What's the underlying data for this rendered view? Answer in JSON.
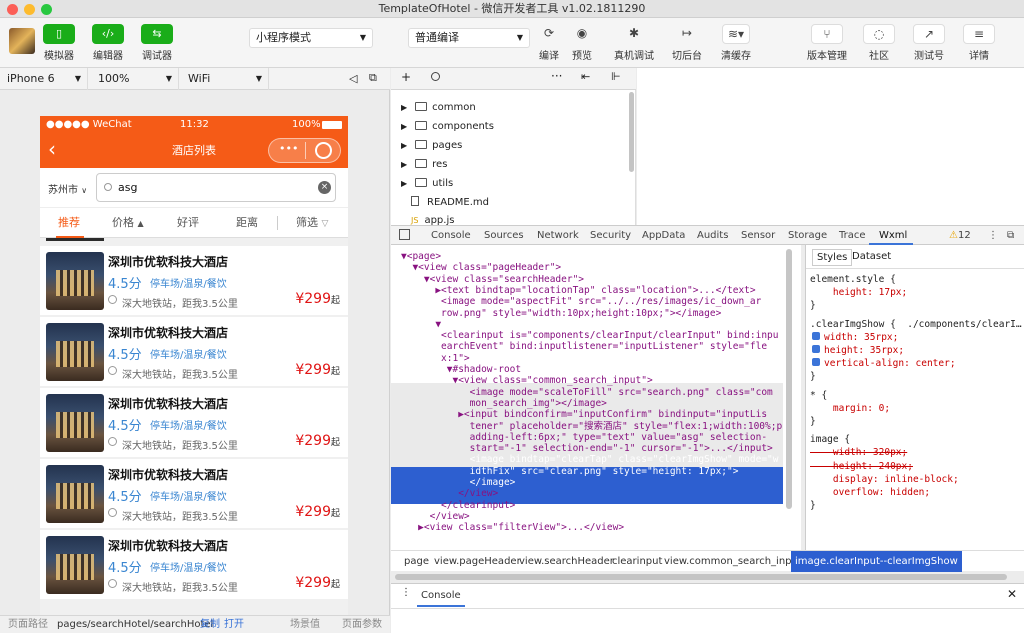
{
  "window": {
    "title": "TemplateOfHotel - 微信开发者工具 v1.02.1811290"
  },
  "toolbar": {
    "simulator": "模拟器",
    "editor": "编辑器",
    "debugger": "调试器",
    "mode_select": "小程序模式",
    "compile_select": "普通编译",
    "compile": "编译",
    "preview": "预览",
    "remote_debug": "真机调试",
    "background": "切后台",
    "clear_cache": "清缓存",
    "version": "版本管理",
    "community": "社区",
    "test": "测试号",
    "details": "详情"
  },
  "devicebar": {
    "device": "iPhone 6",
    "zoom": "100%",
    "network": "WiFi"
  },
  "phone": {
    "status": {
      "carrier": "●●●●● WeChat",
      "time": "11:32",
      "battery": "100%"
    },
    "nav_title": "酒店列表",
    "city": "苏州市",
    "search_value": "asg",
    "filters": [
      "推荐",
      "价格",
      "好评",
      "距离",
      "筛选"
    ],
    "hotels": [
      {
        "name": "深圳市优软科技大酒店",
        "score": "4.5分",
        "tags": "停车场/温泉/餐饮",
        "address": "深大地铁站，距我3.5公里",
        "price": "¥299",
        "suffix": "起"
      },
      {
        "name": "深圳市优软科技大酒店",
        "score": "4.5分",
        "tags": "停车场/温泉/餐饮",
        "address": "深大地铁站，距我3.5公里",
        "price": "¥299",
        "suffix": "起"
      },
      {
        "name": "深圳市优软科技大酒店",
        "score": "4.5分",
        "tags": "停车场/温泉/餐饮",
        "address": "深大地铁站，距我3.5公里",
        "price": "¥299",
        "suffix": "起"
      },
      {
        "name": "深圳市优软科技大酒店",
        "score": "4.5分",
        "tags": "停车场/温泉/餐饮",
        "address": "深大地铁站，距我3.5公里",
        "price": "¥299",
        "suffix": "起"
      },
      {
        "name": "深圳市优软科技大酒店",
        "score": "4.5分",
        "tags": "停车场/温泉/餐饮",
        "address": "深大地铁站，距我3.5公里",
        "price": "¥299",
        "suffix": "起"
      }
    ]
  },
  "bottombar": {
    "path_label": "页面路径",
    "path": "pages/searchHotel/searchHotel",
    "copy": "复制",
    "open": "打开",
    "scene": "场景值",
    "params": "页面参数"
  },
  "tree": {
    "items": [
      "common",
      "components",
      "pages",
      "res",
      "utils",
      "README.md",
      "app.js"
    ]
  },
  "devtools": {
    "tabs": [
      "Console",
      "Sources",
      "Network",
      "Security",
      "AppData",
      "Audits",
      "Sensor",
      "Storage",
      "Trace",
      "Wxml"
    ],
    "warnings": "12",
    "style_tabs": [
      "Styles",
      "Dataset"
    ],
    "dom_lines": [
      "▼<page>",
      "  ▼<view class=\"pageHeader\">",
      "    ▼<view class=\"searchHeader\">",
      "      ▶<text bindtap=\"locationTap\" class=\"location\">...</text>",
      "       <image mode=\"aspectFit\" src=\"../../res/images/ic_down_ar",
      "       row.png\" style=\"width:10px;height:10px;\"></image>",
      "      ▼",
      "       <clearinput is=\"components/clearInput/clearInput\" bind:inpu",
      "       earchEvent\" bind:inputlistener=\"inputListener\" style=\"fle",
      "       x:1\">",
      "        ▼#shadow-root",
      "         ▼<view class=\"common_search_input\">",
      "            <image mode=\"scaleToFill\" src=\"search.png\" class=\"com",
      "            mon_search_img\"></image>",
      "          ▶<input bindconfirm=\"inputConfirm\" bindinput=\"inputLis",
      "            tener\" placeholder=\"搜索酒店\" style=\"flex:1;width:100%;p",
      "            adding-left:6px;\" type=\"text\" value=\"asg\" selection-",
      "            start=\"-1\" selection-end=\"-1\" cursor=\"-1\">...</input>",
      "            <image bindtap=\"clearTap\" class=\"clearImgShow\" mode=\"w",
      "            idthFix\" src=\"clear.png\" style=\"height: 17px;\">",
      "            </image>",
      "          </view>",
      "       </clearinput>",
      "     </view>",
      "   ▶<view class=\"filterView\">...</view>"
    ],
    "styles": [
      "element.style {",
      "    height: 17px;",
      "}",
      ".clearImgShow {  ./components/clearI…",
      "    width: 35rpx;",
      "    height: 35rpx;",
      "    vertical-align: center;",
      "}",
      "* {",
      "    margin: 0;",
      "}",
      "image {",
      "    width: 320px;",
      "    height: 240px;",
      "    display: inline-block;",
      "    overflow: hidden;",
      "}"
    ],
    "crumbs": [
      "page",
      "view.pageHeader",
      "view.searchHeader",
      "clearinput",
      "view.common_search_input",
      "image.clearInput--clearImgShow"
    ],
    "console_tab": "Console"
  },
  "colors": {
    "accent": "#f55b17",
    "wechat_green": "#1aad19",
    "select_blue": "#3b74d8",
    "price_red": "#e01515"
  }
}
